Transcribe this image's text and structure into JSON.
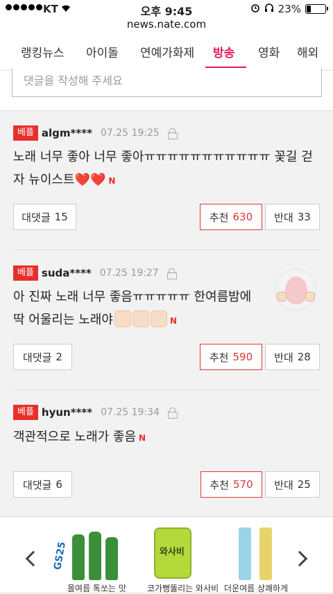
{
  "status": {
    "carrier": "KT",
    "time": "오후 9:45",
    "battery": "23%",
    "battery_fraction": 0.23
  },
  "url": "news.nate.com",
  "tabs": [
    {
      "label": "랭킹뉴스"
    },
    {
      "label": "아이돌"
    },
    {
      "label": "연예가화제"
    },
    {
      "label": "방송"
    },
    {
      "label": "영화"
    },
    {
      "label": "해외"
    }
  ],
  "comment_input": {
    "placeholder": "댓글을 작성해 주세요"
  },
  "comments": [
    {
      "badge": "베플",
      "user": "algm****",
      "time": "07.25 19:25",
      "text_line1": "노래 너무 좋아 너무 좋아ㅠㅠㅠㅠㅠㅠㅠㅠㅠㅠㅠ 꽃길 걷",
      "text_line2": "자 뉴이스트",
      "hearts": "❤️❤️",
      "new_mark": "N",
      "reply_label": "대댓글",
      "reply_count": "15",
      "like_label": "추천",
      "like_count": "630",
      "dislike_label": "반대",
      "dislike_count": "33"
    },
    {
      "badge": "베플",
      "user": "suda****",
      "time": "07.25 19:27",
      "text_line1": "아 진짜 노래 너무 좋음ㅠㅠㅠㅠㅠ 한여름밤에",
      "text_line2": "딱 어울리는 노래야",
      "new_mark": "N",
      "reply_label": "대댓글",
      "reply_count": "2",
      "like_label": "추천",
      "like_count": "590",
      "dislike_label": "반대",
      "dislike_count": "28"
    },
    {
      "badge": "베플",
      "user": "hyun****",
      "time": "07.25 19:34",
      "text_line1": "객관적으로 노래가 좋음",
      "new_mark": "N",
      "reply_label": "대댓글",
      "reply_count": "6",
      "like_label": "추천",
      "like_count": "570",
      "dislike_label": "반대",
      "dislike_count": "25"
    }
  ],
  "ad": {
    "brand": "GS25",
    "products": [
      {
        "caption": "올여름 톡쏘는 맛"
      },
      {
        "caption": "코가뻥뚫리는 와사비",
        "label": "와사비"
      },
      {
        "caption": "더운여름 상쾌하게"
      }
    ]
  },
  "colors": {
    "accent": "#e8175d",
    "badge": "#e62f2b",
    "recommend": "#d9383a"
  }
}
